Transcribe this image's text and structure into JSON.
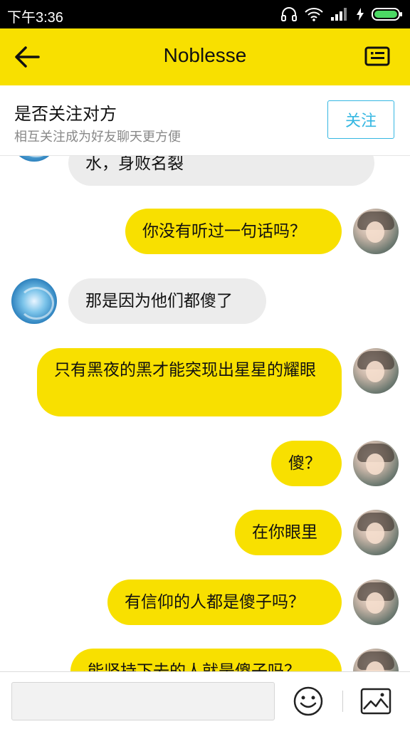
{
  "status_bar": {
    "time": "下午3:36"
  },
  "header": {
    "title": "Noblesse"
  },
  "follow": {
    "title": "是否关注对方",
    "subtitle": "相互关注成为好友聊天更方便",
    "button_label": "关注"
  },
  "messages": [
    {
      "side": "left",
      "text": "水，身败名裂"
    },
    {
      "side": "right",
      "text": "你没有听过一句话吗？"
    },
    {
      "side": "left",
      "text": "那是因为他们都傻了"
    },
    {
      "side": "right",
      "text": "只有黑夜的黑才能突现出星星的耀眼"
    },
    {
      "side": "right",
      "text": "傻？"
    },
    {
      "side": "right",
      "text": "在你眼里"
    },
    {
      "side": "right",
      "text": "有信仰的人都是傻子吗？"
    },
    {
      "side": "right",
      "text": "能坚持下去的人就是傻子吗？"
    }
  ],
  "input": {
    "placeholder": ""
  },
  "colors": {
    "accent": "#F8E000",
    "follow": "#35b7e2",
    "bubble_left": "#ececec"
  }
}
